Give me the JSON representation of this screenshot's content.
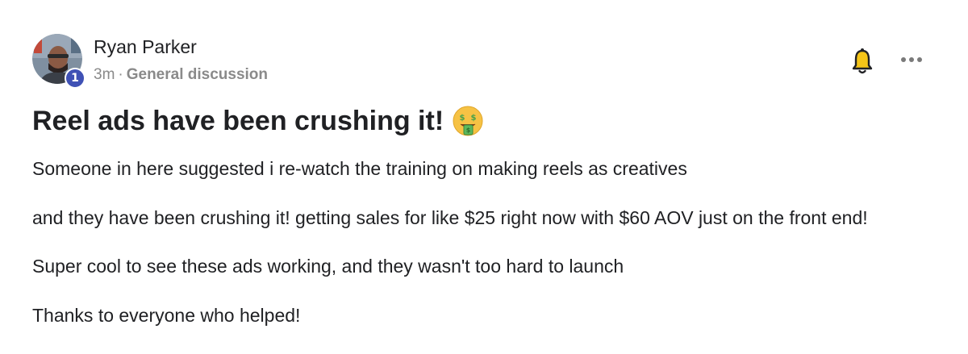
{
  "post": {
    "author": "Ryan Parker",
    "level": "1",
    "time": "3m",
    "separator": "·",
    "category": "General discussion",
    "title": "Reel ads have been crushing it!",
    "title_emoji": "money-mouth-face-icon",
    "paragraphs": [
      "Someone in here suggested i re-watch the training on making reels as creatives",
      "and they have been crushing it! getting sales for like $25 right now with $60 AOV just on the front end!",
      "Super cool to see these ads working, and they wasn't too hard to launch",
      "Thanks to everyone who helped!"
    ]
  },
  "actions": {
    "bell": "bell-icon",
    "more": "more-options-icon"
  },
  "colors": {
    "badge": "#3f51b5",
    "meta": "#8a8a8a",
    "text": "#202124"
  }
}
